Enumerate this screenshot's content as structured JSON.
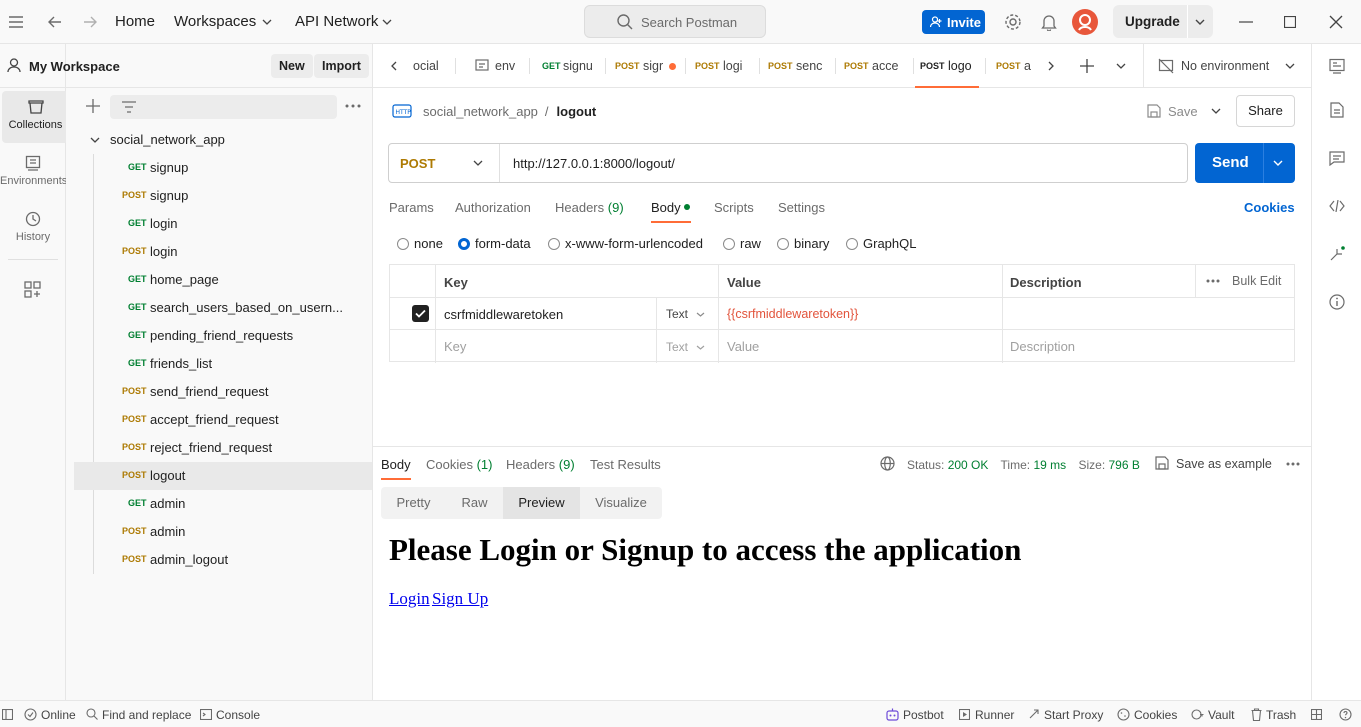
{
  "topbar": {
    "home": "Home",
    "workspaces": "Workspaces",
    "api_network": "API Network",
    "search_placeholder": "Search Postman",
    "invite": "Invite",
    "upgrade": "Upgrade"
  },
  "leftrail": {
    "items": [
      {
        "label": "Collections",
        "icon": "collections-icon"
      },
      {
        "label": "Environments",
        "icon": "environments-icon"
      },
      {
        "label": "History",
        "icon": "history-icon"
      }
    ]
  },
  "sidebar": {
    "workspace_title": "My Workspace",
    "new_label": "New",
    "import_label": "Import",
    "collection_name": "social_network_app",
    "requests": [
      {
        "method": "GET",
        "name": "signup"
      },
      {
        "method": "POST",
        "name": "signup"
      },
      {
        "method": "GET",
        "name": "login"
      },
      {
        "method": "POST",
        "name": "login"
      },
      {
        "method": "GET",
        "name": "home_page"
      },
      {
        "method": "GET",
        "name": "search_users_based_on_usern..."
      },
      {
        "method": "GET",
        "name": "pending_friend_requests"
      },
      {
        "method": "GET",
        "name": "friends_list"
      },
      {
        "method": "POST",
        "name": "send_friend_request"
      },
      {
        "method": "POST",
        "name": "accept_friend_request"
      },
      {
        "method": "POST",
        "name": "reject_friend_request"
      },
      {
        "method": "POST",
        "name": "logout"
      },
      {
        "method": "GET",
        "name": "admin"
      },
      {
        "method": "POST",
        "name": "admin"
      },
      {
        "method": "POST",
        "name": "admin_logout"
      }
    ]
  },
  "tabs": [
    {
      "method": "",
      "name": "ocial"
    },
    {
      "method": "",
      "name": "env"
    },
    {
      "method": "GET",
      "name": "signu"
    },
    {
      "method": "POST",
      "name": "sigr"
    },
    {
      "method": "POST",
      "name": "logi"
    },
    {
      "method": "POST",
      "name": "senc"
    },
    {
      "method": "POST",
      "name": "acce"
    },
    {
      "method": "POST",
      "name": "logo"
    },
    {
      "method": "POST",
      "name": "a"
    }
  ],
  "environment": "No environment",
  "breadcrumb": {
    "collection": "social_network_app",
    "separator": "/",
    "request": "logout"
  },
  "actions": {
    "save": "Save",
    "share": "Share"
  },
  "request": {
    "method": "POST",
    "url": "http://127.0.0.1:8000/logout/",
    "send": "Send",
    "tabs": {
      "params": "Params",
      "authorization": "Authorization",
      "headers": "Headers",
      "headers_count": "(9)",
      "body": "Body",
      "scripts": "Scripts",
      "settings": "Settings",
      "cookies": "Cookies"
    },
    "body_types": [
      "none",
      "form-data",
      "x-www-form-urlencoded",
      "raw",
      "binary",
      "GraphQL"
    ],
    "table": {
      "headers": {
        "key": "Key",
        "value": "Value",
        "description": "Description",
        "bulk_edit": "Bulk Edit"
      },
      "row": {
        "key": "csrfmiddlewaretoken",
        "type": "Text",
        "value": "{{csrfmiddlewaretoken}}"
      },
      "placeholder": {
        "key": "Key",
        "type": "Text",
        "value": "Value",
        "description": "Description"
      }
    }
  },
  "response": {
    "tabs": {
      "body": "Body",
      "cookies": "Cookies",
      "cookies_count": "(1)",
      "headers": "Headers",
      "headers_count": "(9)",
      "test_results": "Test Results"
    },
    "status_label": "Status:",
    "status_value": "200 OK",
    "time_label": "Time:",
    "time_value": "19 ms",
    "size_label": "Size:",
    "size_value": "796 B",
    "save_example": "Save as example",
    "view_tabs": [
      "Pretty",
      "Raw",
      "Preview",
      "Visualize"
    ],
    "preview": {
      "heading": "Please Login or Signup to access the application",
      "link1": "Login",
      "link2": "Sign Up"
    }
  },
  "statusbar": {
    "online": "Online",
    "find_replace": "Find and replace",
    "console": "Console",
    "postbot": "Postbot",
    "runner": "Runner",
    "start_proxy": "Start Proxy",
    "cookies": "Cookies",
    "vault": "Vault",
    "trash": "Trash"
  },
  "colors": {
    "primary": "#0265d2",
    "get": "#007f31",
    "post": "#ad7a03",
    "accent": "#ff6c37",
    "variable": "#e2543c",
    "status_ok": "#007f31"
  }
}
